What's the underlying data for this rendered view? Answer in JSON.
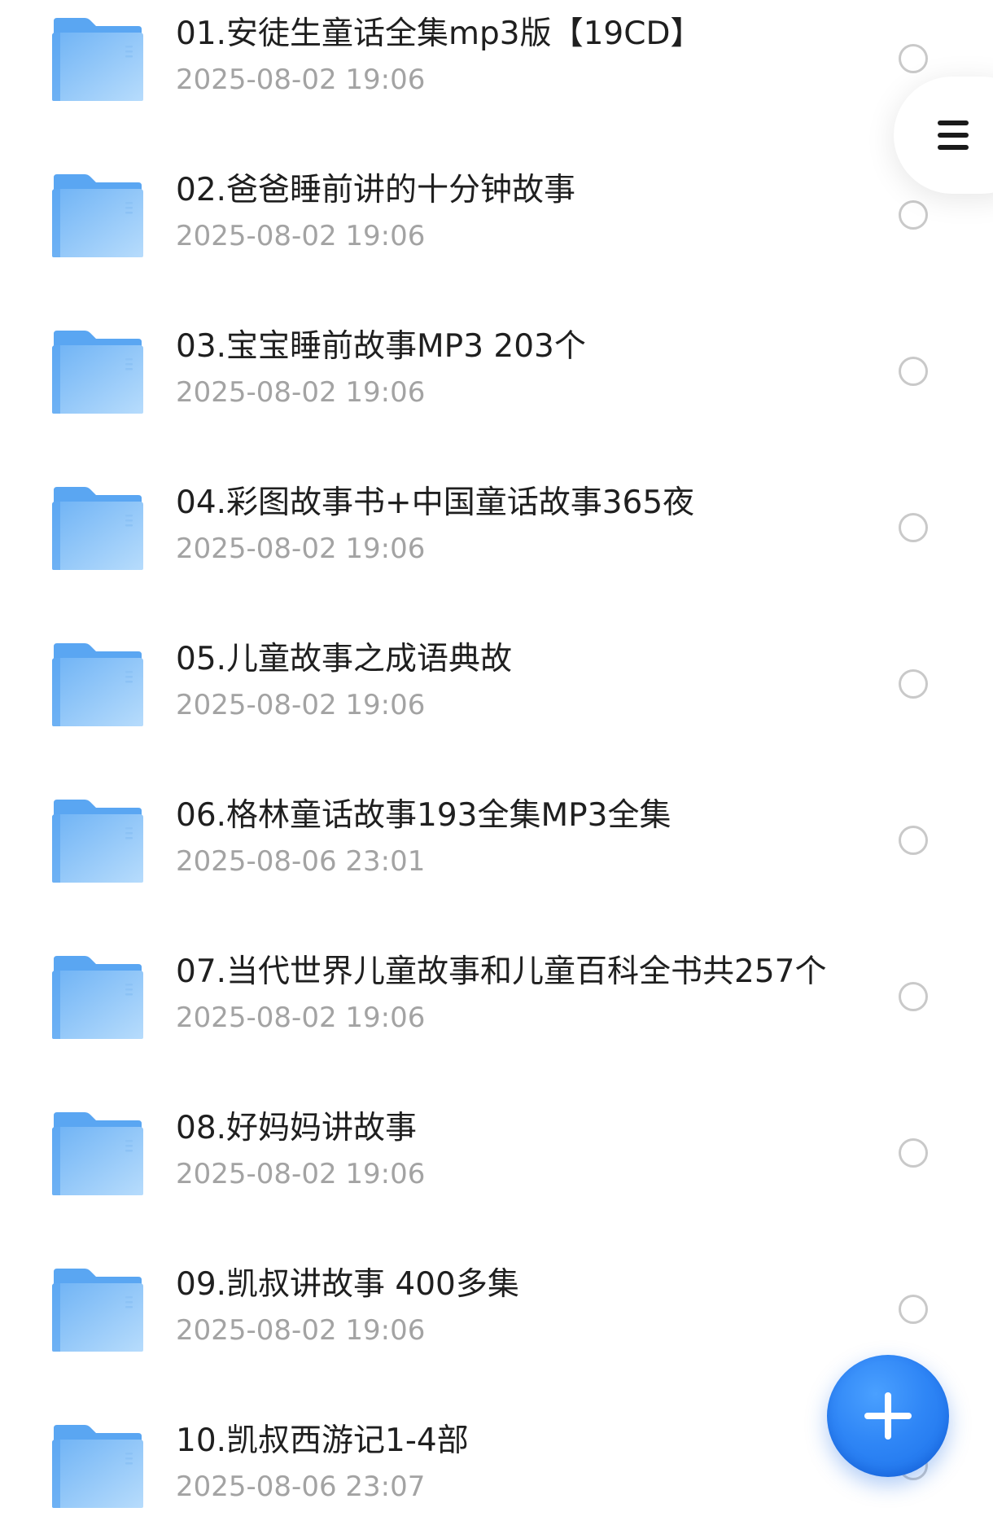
{
  "files": [
    {
      "name": "01.安徒生童话全集mp3版【19CD】",
      "date": "2025-08-02 19:06"
    },
    {
      "name": "02.爸爸睡前讲的十分钟故事",
      "date": "2025-08-02 19:06"
    },
    {
      "name": "03.宝宝睡前故事MP3 203个",
      "date": "2025-08-02 19:06"
    },
    {
      "name": "04.彩图故事书+中国童话故事365夜",
      "date": "2025-08-02 19:06"
    },
    {
      "name": "05.儿童故事之成语典故",
      "date": "2025-08-02 19:06"
    },
    {
      "name": "06.格林童话故事193全集MP3全集",
      "date": "2025-08-06 23:01"
    },
    {
      "name": "07.当代世界儿童故事和儿童百科全书共257个",
      "date": "2025-08-02 19:06"
    },
    {
      "name": "08.好妈妈讲故事",
      "date": "2025-08-02 19:06"
    },
    {
      "name": "09.凯叔讲故事 400多集",
      "date": "2025-08-02 19:06"
    },
    {
      "name": "10.凯叔西游记1-4部",
      "date": "2025-08-06 23:07"
    }
  ],
  "icons": {
    "folder": "folder-icon",
    "menu": "hamburger-menu-icon",
    "add": "plus-icon",
    "select": "radio-circle-icon"
  },
  "colors": {
    "folder_light": "#a9d4fb",
    "folder_dark": "#4f9ef0",
    "fab_blue": "#2f86f6",
    "title_text": "#1f1f1f",
    "date_text": "#a3a3a3"
  }
}
